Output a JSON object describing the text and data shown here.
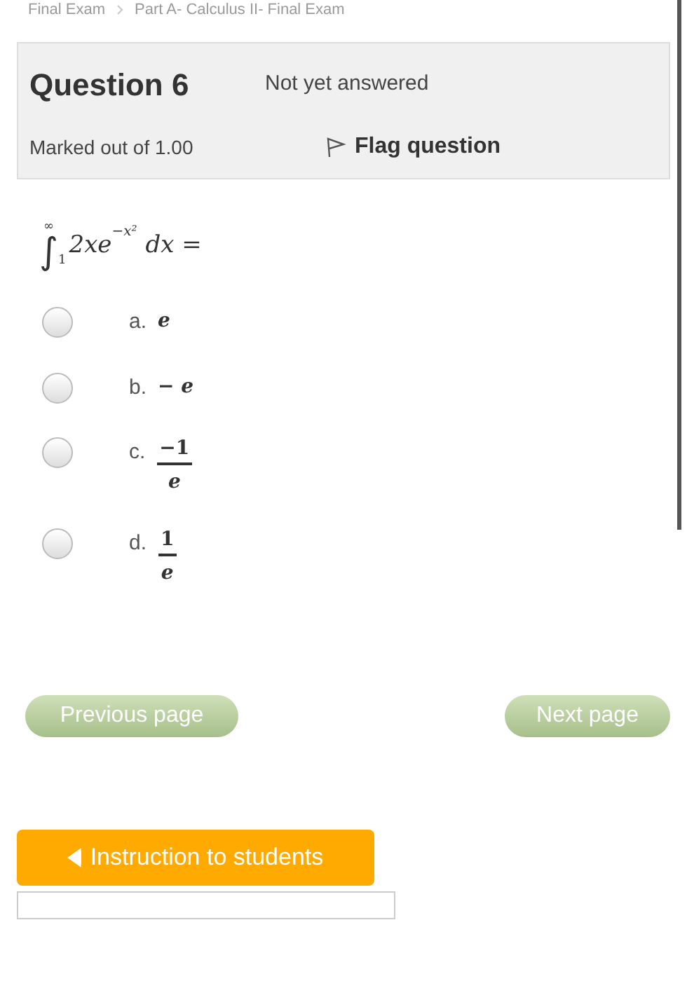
{
  "breadcrumb": [
    "Final Exam",
    "Part A- Calculus II- Final Exam"
  ],
  "info": {
    "title": "Question 6",
    "status": "Not yet answered",
    "marks": "Marked out of 1.00",
    "flag": "Flag question"
  },
  "question": {
    "sign": "∫",
    "upper": "∞",
    "lower": "1",
    "integrand": "2xe",
    "exponent": "−x²",
    "tail": "dx ="
  },
  "options": [
    {
      "letter": "a.",
      "kind": "plain",
      "text": "e",
      "selected": false
    },
    {
      "letter": "b.",
      "kind": "plain",
      "text": "− e",
      "selected": false
    },
    {
      "letter": "c.",
      "kind": "fraction",
      "numerator": "−1",
      "denominator": "e",
      "selected": false
    },
    {
      "letter": "d.",
      "kind": "fraction",
      "numerator": "1",
      "denominator": "e",
      "selected": false
    }
  ],
  "nav": {
    "previous": "Previous page",
    "next": "Next page"
  },
  "instruction": "Instruction to students"
}
